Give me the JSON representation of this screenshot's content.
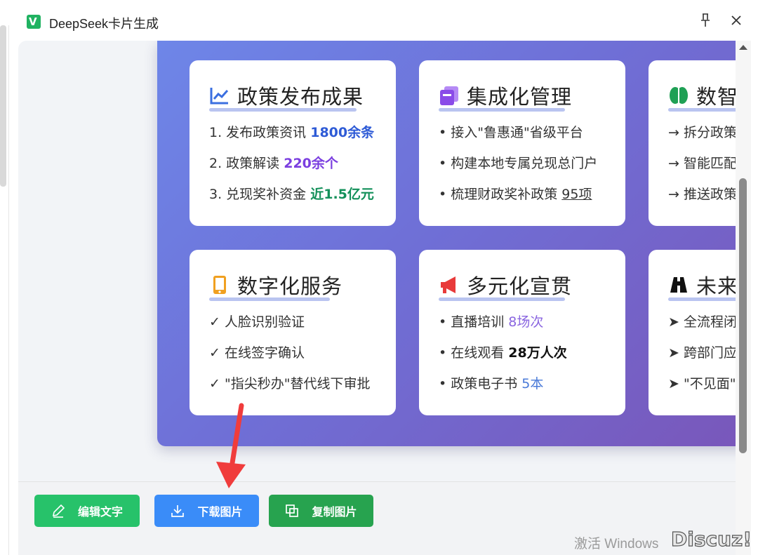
{
  "window": {
    "title": "DeepSeek卡片生成",
    "logo_letter": "V",
    "pin_glyph": "📌",
    "close_glyph": "✕",
    "pin_icon": "pin-icon",
    "close_icon": "close-icon"
  },
  "cards": [
    {
      "icon": "line-chart-icon",
      "icon_color": "#3b6fe0",
      "title": "政策发布成果",
      "items": [
        {
          "text": "1. 发布政策资讯 ",
          "highlight": "1800余条",
          "style": "hl-blue"
        },
        {
          "text": "2. 政策解读 ",
          "highlight": "220余个",
          "style": "hl-purple"
        },
        {
          "text": "3. 兑现奖补资金 ",
          "highlight": "近1.5亿元",
          "style": "hl-green"
        }
      ]
    },
    {
      "icon": "layers-icon",
      "icon_color": "#8a4be8",
      "title": "集成化管理",
      "items": [
        {
          "text": "• 接入\"鲁惠通\"省级平台",
          "highlight": "",
          "style": ""
        },
        {
          "text": "• 构建本地专属兑现总门户",
          "highlight": "",
          "style": ""
        },
        {
          "text": "• 梳理财政奖补政策 ",
          "highlight": "95项",
          "style": "underline"
        }
      ]
    },
    {
      "icon": "brain-icon",
      "icon_color": "#1fa055",
      "title": "数智",
      "items": [
        {
          "text": "→ 拆分政策",
          "highlight": "",
          "style": ""
        },
        {
          "text": "→ 智能匹配",
          "highlight": "",
          "style": ""
        },
        {
          "text": "→ 推送政策",
          "highlight": "",
          "style": ""
        }
      ]
    },
    {
      "icon": "mobile-phone-icon",
      "icon_color": "#f0a020",
      "title": "数字化服务",
      "items": [
        {
          "text": "✓ 人脸识别验证",
          "highlight": "",
          "style": ""
        },
        {
          "text": "✓ 在线签字确认",
          "highlight": "",
          "style": ""
        },
        {
          "text": "✓ \"指尖秒办\"替代线下审批",
          "highlight": "",
          "style": ""
        }
      ]
    },
    {
      "icon": "megaphone-icon",
      "icon_color": "#e83a3a",
      "title": "多元化宣贯",
      "items": [
        {
          "text": "• 直播培训 ",
          "highlight": "8场次",
          "style": "hl-lilac"
        },
        {
          "text": "• 在线观看 ",
          "highlight": "28万人次",
          "style": "hl-dark"
        },
        {
          "text": "• 政策电子书 ",
          "highlight": "5本",
          "style": "hl-sky"
        }
      ]
    },
    {
      "icon": "binoculars-icon",
      "icon_color": "#111111",
      "title": "未来",
      "items": [
        {
          "text": "➤ 全流程闭",
          "highlight": "",
          "style": ""
        },
        {
          "text": "➤ 跨部门应",
          "highlight": "",
          "style": ""
        },
        {
          "text": "➤ \"不见面\"",
          "highlight": "",
          "style": ""
        }
      ]
    }
  ],
  "toolbar": {
    "edit_label": "编辑文字",
    "download_label": "下载图片",
    "copy_label": "复制图片",
    "edit_icon": "pencil-icon",
    "download_icon": "download-icon",
    "copy_icon": "copy-icon"
  },
  "status": {
    "text": "……"
  },
  "watermark": {
    "windows": "激活 Windows",
    "discuz": "Discuz!"
  },
  "colors": {
    "poster_gradient_start": "#6e86e8",
    "poster_gradient_end": "#7a55b8",
    "edit_button": "#27c26a",
    "download_button": "#3a8cf8",
    "copy_button": "#27a34f",
    "annotation_arrow": "#f03c3c"
  }
}
